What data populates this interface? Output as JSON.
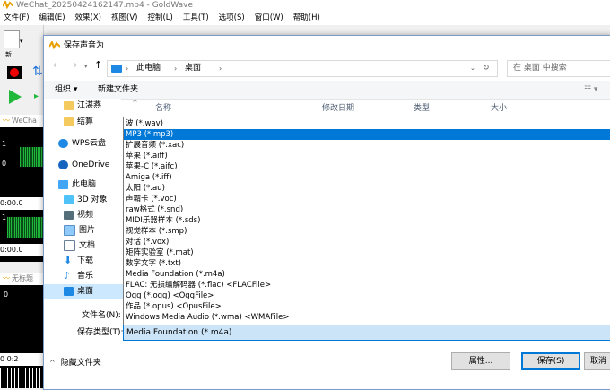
{
  "main_window": {
    "title": "WeChat_20250424162147.mp4 - GoldWave",
    "menu": [
      "文件(F)",
      "编辑(E)",
      "效果(X)",
      "视图(V)",
      "控制(L)",
      "工具(T)",
      "选项(S)",
      "窗口(W)",
      "帮助(H)"
    ],
    "new_label": "新",
    "child_window_1": "WeCha",
    "child_window_2": "无标题",
    "time_labels": [
      "0:00.0",
      "0:00.0",
      "0 0:2"
    ],
    "channel_labels": [
      "1",
      "0",
      "1",
      "0"
    ]
  },
  "dialog": {
    "title": "保存声音为",
    "breadcrumb": [
      "此电脑",
      "桌面"
    ],
    "search_placeholder": "在 桌面 中搜索",
    "organize_label": "组织 ▾",
    "new_folder_label": "新建文件夹",
    "nav_items": [
      {
        "label": "江湛燕",
        "icon": "folder-icon"
      },
      {
        "label": "结算",
        "icon": "folder-icon"
      },
      {
        "label": "WPS云盘",
        "icon": "cloud-icon"
      },
      {
        "label": "OneDrive",
        "icon": "cloud-icon"
      },
      {
        "label": "此电脑",
        "icon": "computer-icon"
      },
      {
        "label": "3D 对象",
        "icon": "cube-icon"
      },
      {
        "label": "视频",
        "icon": "video-icon"
      },
      {
        "label": "图片",
        "icon": "picture-icon"
      },
      {
        "label": "文档",
        "icon": "document-icon"
      },
      {
        "label": "下载",
        "icon": "download-icon"
      },
      {
        "label": "音乐",
        "icon": "music-icon"
      },
      {
        "label": "桌面",
        "icon": "desktop-icon"
      }
    ],
    "columns": [
      "名称",
      "修改日期",
      "类型",
      "大小"
    ],
    "file_types": [
      "波 (*.wav)",
      "MP3 (*.mp3)",
      "扩展音频 (*.xac)",
      "苹果 (*.aiff)",
      "苹果-C (*.aifc)",
      "Amiga (*.iff)",
      "太阳 (*.au)",
      "声霸卡 (*.voc)",
      "raw格式 (*.snd)",
      "MIDI乐器样本 (*.sds)",
      "视觉样本 (*.smp)",
      "对话 (*.vox)",
      "矩阵实验室 (*.mat)",
      "数字文字 (*.txt)",
      "Media Foundation (*.m4a)",
      "FLAC: 无损编解码器 (*.flac)    <FLACFile>",
      "Ogg (*.ogg)    <OggFile>",
      "作品 (*.opus)    <OpusFile>",
      "Windows Media Audio (*.wma)    <WMAFile>"
    ],
    "selected_index": 1,
    "filename_label": "文件名(N):",
    "filetype_label": "保存类型(T):",
    "filetype_value": "Media Foundation (*.m4a)",
    "hide_folders_label": "隐藏文件夹",
    "attributes_button": "属性...",
    "save_button": "保存(S)",
    "cancel_button": "取消"
  },
  "colors": {
    "accent": "#0078d7",
    "selection": "#0078d7",
    "waveform": "#1fb83a"
  }
}
